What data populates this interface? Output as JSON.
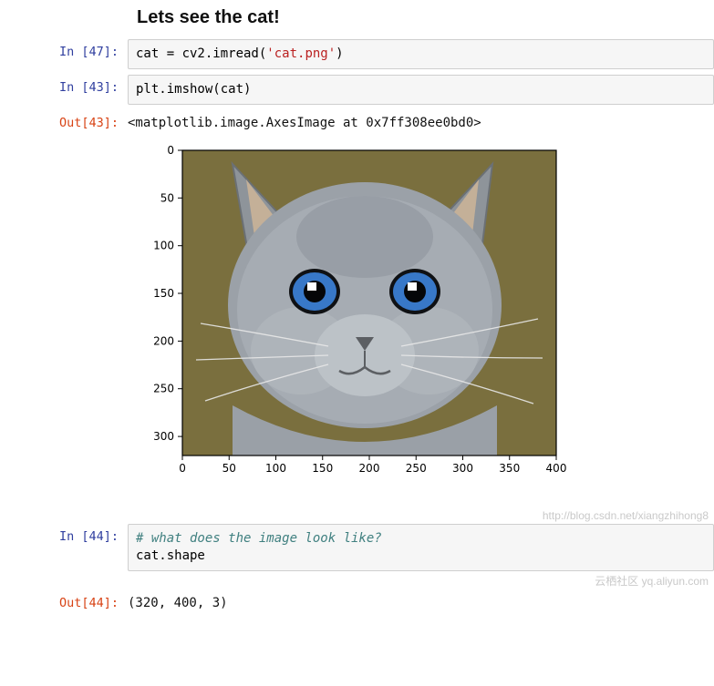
{
  "heading": "Lets see the cat!",
  "cells": {
    "c1": {
      "in_prompt": "In [47]:",
      "code_pre": "cat = cv2.imread(",
      "code_str": "'cat.png'",
      "code_post": ")"
    },
    "c2": {
      "in_prompt": "In [43]:",
      "code": "plt.imshow(cat)",
      "out_prompt": "Out[43]:",
      "out_text": "<matplotlib.image.AxesImage at 0x7ff308ee0bd0>"
    },
    "c3": {
      "in_prompt": "In [44]:",
      "comment": "# what does the image look like?",
      "code_line": "cat.shape",
      "out_prompt": "Out[44]:",
      "out_text": "(320, 400, 3)"
    }
  },
  "chart_data": {
    "type": "image",
    "title": "",
    "xlabel": "",
    "ylabel": "",
    "x_ticks": [
      0,
      50,
      100,
      150,
      200,
      250,
      300,
      350,
      400
    ],
    "y_ticks": [
      0,
      50,
      100,
      150,
      200,
      250,
      300
    ],
    "xlim": [
      0,
      400
    ],
    "ylim": [
      320,
      0
    ],
    "image_shape": [
      320,
      400,
      3
    ],
    "description": "Grey British Shorthair cat with blue eyes on olive background"
  },
  "watermark1": "http://blog.csdn.net/xiangzhihong8",
  "watermark2": "云栖社区 yq.aliyun.com"
}
